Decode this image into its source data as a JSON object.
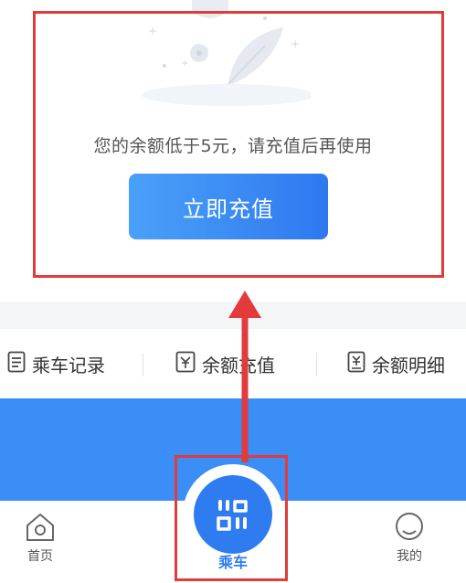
{
  "notice": {
    "message": "您的余额低于5元，请充值后再使用",
    "topup_button": "立即充值"
  },
  "function_bar": {
    "items": [
      {
        "label": "乘车记录",
        "icon": "list-document-icon"
      },
      {
        "label": "余额充值",
        "icon": "wallet-topup-icon"
      },
      {
        "label": "余额明细",
        "icon": "balance-detail-icon"
      }
    ]
  },
  "tabbar": {
    "home": "首页",
    "ride": "乘车",
    "mine": "我的"
  },
  "colors": {
    "accent": "#2f7cf0",
    "highlight": "#e23b3b",
    "band": "#3a8ef6"
  }
}
